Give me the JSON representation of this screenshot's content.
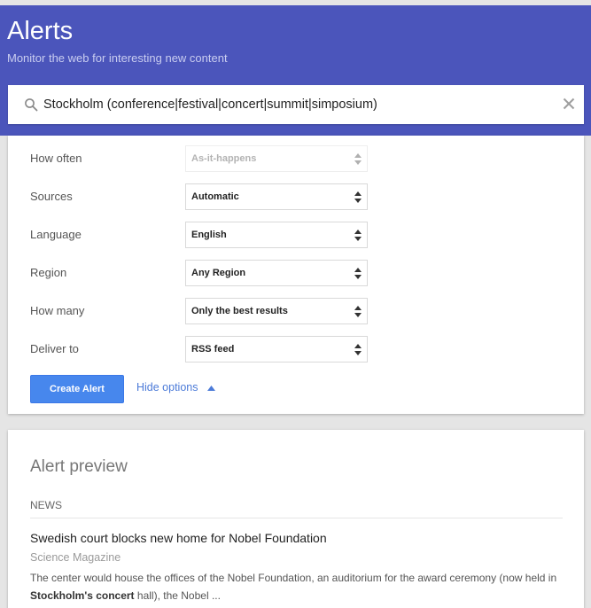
{
  "header": {
    "title": "Alerts",
    "subtitle": "Monitor the web for interesting new content",
    "background_color": "#4b55bb"
  },
  "search": {
    "icon": "search-icon",
    "value": "Stockholm (conference|festival|concert|summit|simposium)",
    "clear_icon": "close-icon"
  },
  "options": [
    {
      "key": "how-often",
      "label": "How often",
      "value": "As-it-happens",
      "disabled": true
    },
    {
      "key": "sources",
      "label": "Sources",
      "value": "Automatic",
      "disabled": false
    },
    {
      "key": "language",
      "label": "Language",
      "value": "English",
      "disabled": false
    },
    {
      "key": "region",
      "label": "Region",
      "value": "Any Region",
      "disabled": false
    },
    {
      "key": "how-many",
      "label": "How many",
      "value": "Only the best results",
      "disabled": false
    },
    {
      "key": "deliver-to",
      "label": "Deliver to",
      "value": "RSS feed",
      "disabled": false
    }
  ],
  "actions": {
    "create_label": "Create Alert",
    "hide_options_label": "Hide options",
    "accent_color": "#4787ed"
  },
  "preview": {
    "title": "Alert preview",
    "section_label": "NEWS",
    "result": {
      "title": "Swedish court blocks new home for Nobel Foundation",
      "source": "Science Magazine",
      "snippet_part1": "The center would house the offices of the Nobel Foundation, an auditorium for the award ceremony (now held in ",
      "snippet_bold": "Stockholm's concert",
      "snippet_part2": " hall), the Nobel ..."
    }
  }
}
